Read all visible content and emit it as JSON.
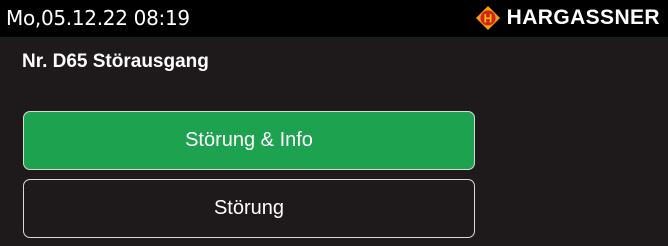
{
  "header": {
    "datetime": "Mo,05.12.22 08:19",
    "brand_name": "HARGASSNER",
    "logo_letter": "H",
    "logo_icon": "hargassner-logo-icon"
  },
  "page": {
    "title": "Nr. D65 Störausgang"
  },
  "options": [
    {
      "label": "Störung & Info",
      "selected": true
    },
    {
      "label": "Störung",
      "selected": false
    }
  ],
  "colors": {
    "topbar": "#000000",
    "background": "#1e1a1b",
    "selected": "#1da24f",
    "logo_outer": "#f2a100",
    "logo_inner": "#d8201c"
  }
}
